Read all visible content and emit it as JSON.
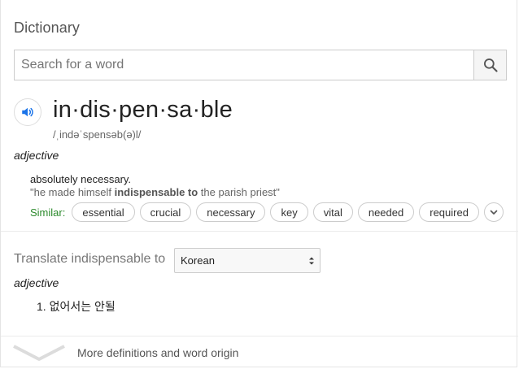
{
  "title": "Dictionary",
  "search": {
    "placeholder": "Search for a word",
    "value": "",
    "button_icon": "search-icon"
  },
  "entry": {
    "audio_icon": "speaker-icon",
    "headword": "in·dis·pen·sa·ble",
    "phonetic": "/ˌindəˈspensəb(ə)l/",
    "part_of_speech": "adjective",
    "definition": "absolutely necessary.",
    "example": {
      "prefix": "\"he made himself ",
      "highlight": "indispensable to",
      "suffix": " the parish priest\""
    },
    "similar_label": "Similar:",
    "similar_words": [
      "essential",
      "crucial",
      "necessary",
      "key",
      "vital",
      "needed",
      "required"
    ],
    "expand_icon": "chevron-down-icon"
  },
  "translate": {
    "label": "Translate indispensable to",
    "selected_language": "Korean",
    "part_of_speech": "adjective",
    "items": [
      "1. 없어서는 안될"
    ]
  },
  "footer": {
    "more_icon": "chevron-down-icon",
    "more_label": "More definitions and word origin"
  },
  "colors": {
    "similar_label": "#2c8a2c",
    "audio_icon": "#1a73e8"
  }
}
